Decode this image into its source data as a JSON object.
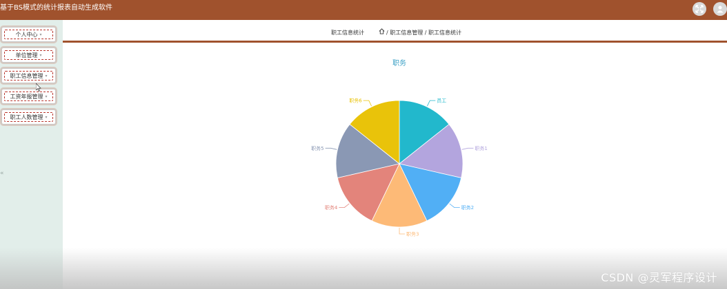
{
  "header": {
    "app_title": "基于BS模式的统计报表自动生成软件",
    "icons": [
      "expand-icon",
      "user-icon"
    ],
    "bg_color": "#a0522d"
  },
  "sidebar": {
    "items": [
      {
        "label": "个人中心"
      },
      {
        "label": "单位管理"
      },
      {
        "label": "职工信息管理"
      },
      {
        "label": "工资年报管理"
      },
      {
        "label": "职工人数管理"
      }
    ],
    "caret": "▾",
    "collapse_arrow": "«"
  },
  "breadcrumb": {
    "page_title": "职工信息统计",
    "path": "/ 职工信息管理 / 职工信息统计"
  },
  "chart_data": {
    "type": "pie",
    "title": "职务",
    "categories": [
      "员工",
      "职务1",
      "职务2",
      "职务3",
      "职务4",
      "职务5",
      "职务6"
    ],
    "values": [
      1,
      1,
      1,
      1,
      1,
      1,
      1
    ],
    "colors": [
      "#22b8cc",
      "#b3a5de",
      "#51aff5",
      "#fdba77",
      "#e3847b",
      "#8a98b4",
      "#e9c30a"
    ]
  },
  "watermark": "CSDN @灵军程序设计"
}
